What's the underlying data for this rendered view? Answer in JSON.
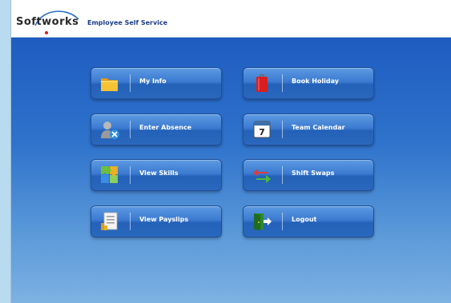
{
  "header": {
    "logo_text": "Softworks",
    "app_title": "Employee Self Service"
  },
  "menu": {
    "my_info": {
      "label": "My Info",
      "icon": "folder-icon"
    },
    "enter_absence": {
      "label": "Enter Absence",
      "icon": "user-absence-icon"
    },
    "view_skills": {
      "label": "View Skills",
      "icon": "puzzle-icon"
    },
    "view_payslips": {
      "label": "View Payslips",
      "icon": "payslip-icon"
    },
    "book_holiday": {
      "label": "Book Holiday",
      "icon": "luggage-icon"
    },
    "team_calendar": {
      "label": "Team Calendar",
      "icon": "calendar-icon",
      "day": "7"
    },
    "shift_swaps": {
      "label": "Shift Swaps",
      "icon": "swap-arrows-icon"
    },
    "logout": {
      "label": "Logout",
      "icon": "exit-door-icon"
    }
  },
  "colors": {
    "brand_blue": "#1b3d8a",
    "panel_top": "#1e5cbf",
    "panel_bottom": "#7db2e3",
    "logo_dot": "#d42020"
  }
}
